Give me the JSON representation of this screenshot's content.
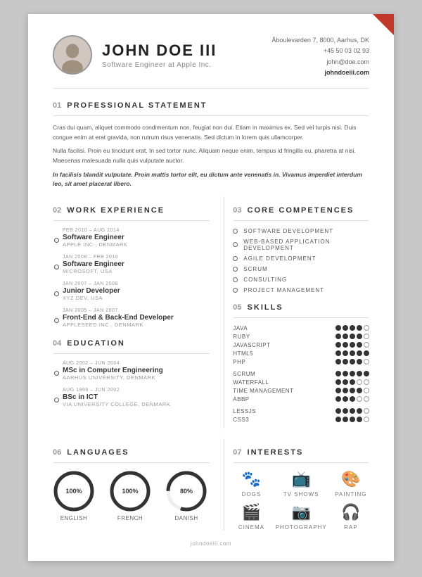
{
  "header": {
    "name": "JOHN DOE III",
    "subtitle": "Software Engineer at Apple Inc.",
    "address": "Åboulevarden 7, 8000, Aarhus, DK",
    "phone": "+45 50 03 02 93",
    "email": "john@doe.com",
    "website": "johndoeiii.com"
  },
  "sections": {
    "professional": {
      "num": "01",
      "title": "PROFESSIONAL STATEMENT",
      "para1": "Cras dui quam, aliquet commodo condimentum non, feugiat non dui. Etiam in maximus ex. Sed vel turpis nisi. Duis congue enim at erat gravida, non rutrum risus venenatis. Sed dictum in lorem quis ullamcorper.",
      "para2": "Nulla facilisi. Proin eu tincidunt erat. In sed tortor nunc. Aliquam neque enim, tempus id fringilla eu, pharetra at nisi. Maecenas malesuada nulla quis vulputate auctor.",
      "para3": "In facilisis blandit vulputate. Proin mattis tortor elit, eu dictum ante venenatis in. Vivamus imperdiet interdum leo, sit amet placerat libero."
    },
    "work": {
      "num": "02",
      "title": "WORK EXPERIENCE",
      "items": [
        {
          "date": "FEB 2010 – AUG 2014",
          "title": "Software Engineer",
          "company": "APPLE INC., DENMARK"
        },
        {
          "date": "JAN 2008 – FEB 2010",
          "title": "Software Engineer",
          "company": "MICROSOFT, USA"
        },
        {
          "date": "JAN 2007 – JAN 2008",
          "title": "Junior Developer",
          "company": "XYZ DEV, USA"
        },
        {
          "date": "JAN 2005 – JAN 2007",
          "title": "Front-End & Back-End Developer",
          "company": "APPLESEED INC., DENMARK"
        }
      ]
    },
    "education": {
      "num": "04",
      "title": "EDUCATION",
      "items": [
        {
          "date": "AUG 2002 – JUN 2004",
          "title": "MSc in Computer Engineering",
          "company": "AARHUS UNIVERSITY, DENMARK"
        },
        {
          "date": "AUG 1998 – JUN 2002",
          "title": "BSc in ICT",
          "company": "VIA UNIVERSITY COLLEGE, DENMARK"
        }
      ]
    },
    "core": {
      "num": "03",
      "title": "CORE COMPETENCES",
      "items": [
        "SOFTWARE DEVELOPMENT",
        "WEB-BASED APPLICATION DEVELOPMENT",
        "AGILE DEVELOPMENT",
        "SCRUM",
        "CONSULTING",
        "PROJECT MANAGEMENT"
      ]
    },
    "skills": {
      "num": "05",
      "title": "SKILLS",
      "groups": [
        {
          "items": [
            {
              "name": "JAVA",
              "filled": 4,
              "empty": 1
            },
            {
              "name": "RUBY",
              "filled": 4,
              "empty": 1
            },
            {
              "name": "JAVASCRIPT",
              "filled": 4,
              "empty": 1
            },
            {
              "name": "HTML5",
              "filled": 5,
              "empty": 0
            },
            {
              "name": "PHP",
              "filled": 4,
              "empty": 1
            }
          ]
        },
        {
          "items": [
            {
              "name": "SCRUM",
              "filled": 5,
              "empty": 0
            },
            {
              "name": "WATERFALL",
              "filled": 3,
              "empty": 2
            },
            {
              "name": "TIME MANAGEMENT",
              "filled": 4,
              "empty": 1
            },
            {
              "name": "ABBP",
              "filled": 3,
              "empty": 2
            }
          ]
        },
        {
          "items": [
            {
              "name": "LESSJS",
              "filled": 4,
              "empty": 1
            },
            {
              "name": "CSS3",
              "filled": 4,
              "empty": 1
            }
          ]
        }
      ]
    },
    "languages": {
      "num": "06",
      "title": "LANGUAGES",
      "items": [
        {
          "name": "ENGLISH",
          "percent": 100
        },
        {
          "name": "FRENCH",
          "percent": 100
        },
        {
          "name": "DANISH",
          "percent": 80
        }
      ]
    },
    "interests": {
      "num": "07",
      "title": "INTERESTS",
      "items": [
        {
          "label": "DOGS",
          "icon": "🐾"
        },
        {
          "label": "TV SHOWS",
          "icon": "📺"
        },
        {
          "label": "PAINTING",
          "icon": "🎨"
        },
        {
          "label": "CINEMA",
          "icon": "🎬"
        },
        {
          "label": "PHOTOGRAPHY",
          "icon": "📷"
        },
        {
          "label": "RAP",
          "icon": "🎧"
        }
      ]
    }
  },
  "footer": {
    "url": "johndoeiii.com"
  }
}
